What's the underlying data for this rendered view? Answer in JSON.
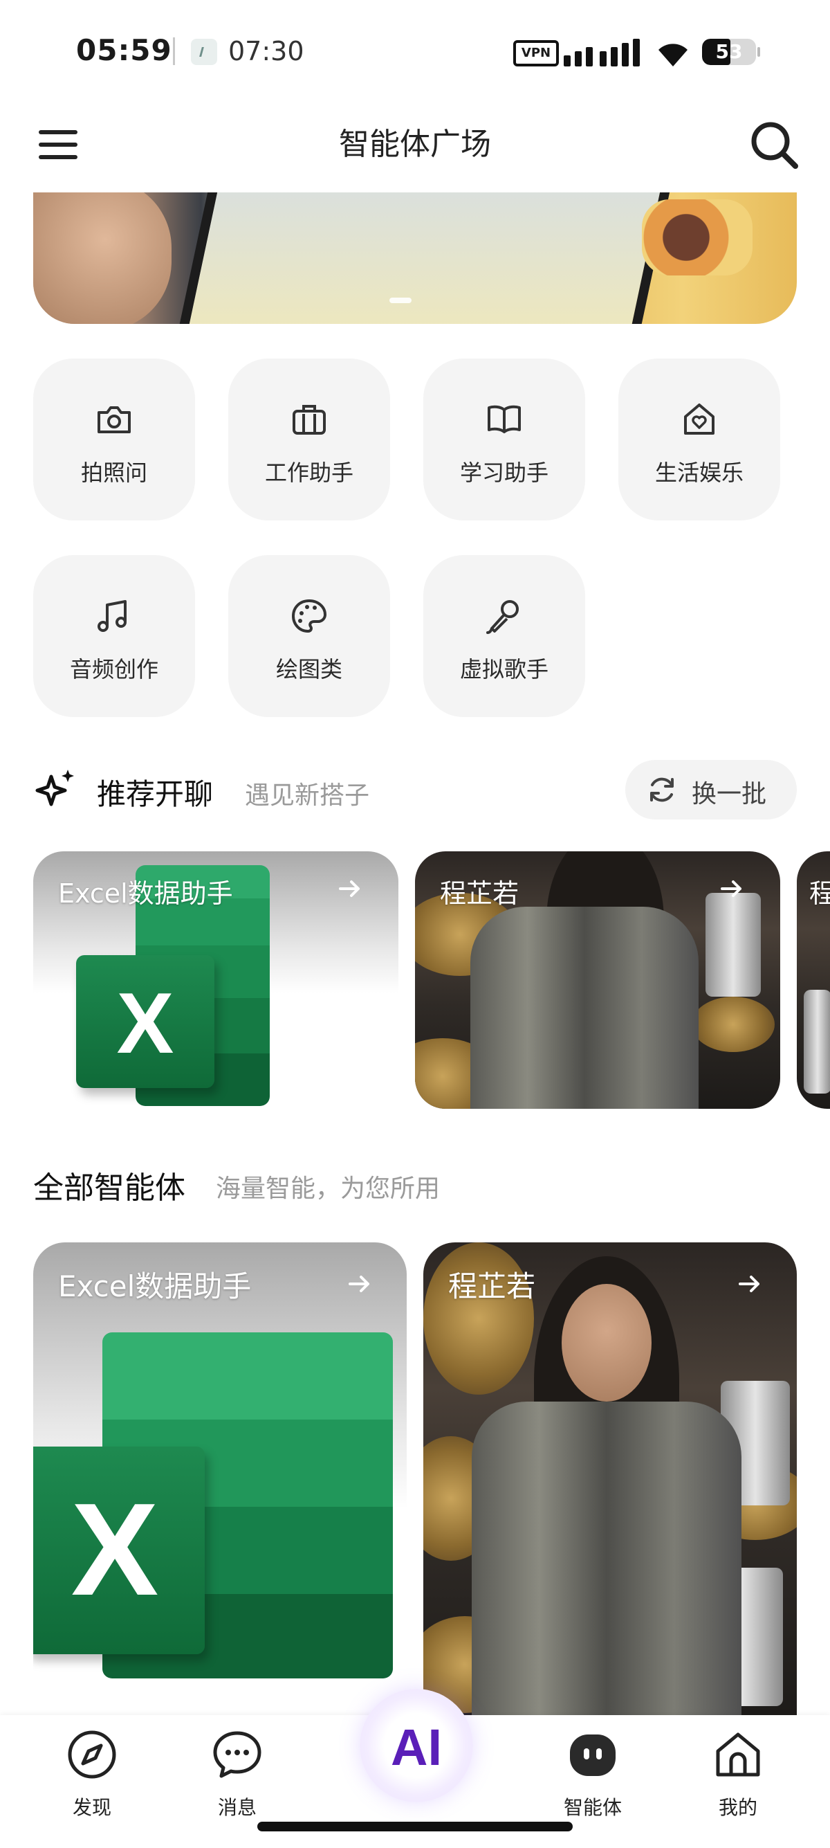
{
  "status_bar": {
    "time": "05:59",
    "secondary_time": "07:30",
    "vpn_label": "VPN",
    "battery": "53",
    "battery_level": 0.53
  },
  "app_bar": {
    "title": "智能体广场",
    "menu_icon": "hamburger-menu-icon",
    "search_icon": "search-icon"
  },
  "banner": {
    "page_indicator_count": 1
  },
  "categories": [
    {
      "label": "拍照问",
      "icon": "camera-icon"
    },
    {
      "label": "工作助手",
      "icon": "briefcase-icon"
    },
    {
      "label": "学习助手",
      "icon": "book-icon"
    },
    {
      "label": "生活娱乐",
      "icon": "home-heart-icon"
    },
    {
      "label": "音频创作",
      "icon": "music-note-icon"
    },
    {
      "label": "绘图类",
      "icon": "palette-icon"
    },
    {
      "label": "虚拟歌手",
      "icon": "microphone-icon"
    }
  ],
  "recommend": {
    "title": "推荐开聊",
    "subtitle": "遇见新搭子",
    "refresh_label": "换一批",
    "cards": [
      {
        "title": "Excel数据助手"
      },
      {
        "title": "程芷若"
      },
      {
        "title": "程"
      }
    ]
  },
  "all_agents": {
    "title": "全部智能体",
    "subtitle": "海量智能，为您所用",
    "cards": [
      {
        "title": "Excel数据助手"
      },
      {
        "title": "程芷若"
      }
    ]
  },
  "bottom_nav": {
    "items": [
      {
        "label": "发现",
        "icon": "compass-icon"
      },
      {
        "label": "消息",
        "icon": "chat-bubble-icon"
      },
      {
        "label": "智能体",
        "icon": "agent-icon"
      },
      {
        "label": "我的",
        "icon": "home-icon"
      }
    ],
    "center_label": "AI"
  },
  "colors": {
    "accent_purple": "#5a1fb8",
    "excel_green": "#107c41",
    "tile_bg": "#f4f4f4",
    "subtitle_gray": "#9a9a9a"
  }
}
